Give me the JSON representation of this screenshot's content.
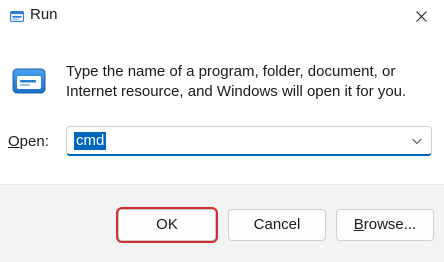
{
  "window": {
    "title": "Run",
    "close_symbol": "✕"
  },
  "description": "Type the name of a program, folder, document, or Internet resource, and Windows will open it for you.",
  "open_field": {
    "label_accel": "O",
    "label_rest": "pen:",
    "value": "cmd"
  },
  "buttons": {
    "ok": "OK",
    "cancel": "Cancel",
    "browse_accel": "B",
    "browse_rest": "rowse..."
  },
  "colors": {
    "accent": "#0067c0",
    "highlight_box": "#d32f2f"
  },
  "icons": {
    "title": "run-icon",
    "main": "run-icon",
    "dropdown": "chevron-down-icon",
    "close": "close-icon"
  }
}
